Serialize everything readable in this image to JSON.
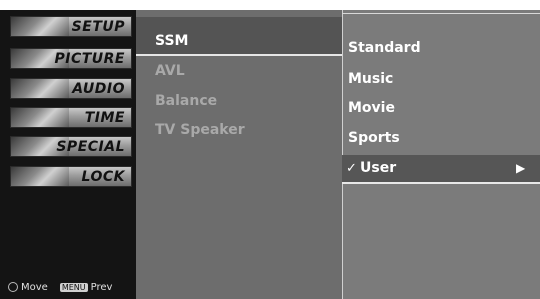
{
  "sidebar": {
    "items": [
      {
        "label": "SETUP"
      },
      {
        "label": "PICTURE"
      },
      {
        "label": "AUDIO"
      },
      {
        "label": "TIME"
      },
      {
        "label": "SPECIAL"
      },
      {
        "label": "LOCK"
      }
    ],
    "help": {
      "move_label": "Move",
      "menu_key": "MENU",
      "prev_label": "Prev"
    }
  },
  "audio_menu": {
    "items": [
      {
        "label": "SSM"
      },
      {
        "label": "AVL"
      },
      {
        "label": "Balance"
      },
      {
        "label": "TV Speaker"
      }
    ]
  },
  "ssm_options": {
    "items": [
      {
        "label": "Standard"
      },
      {
        "label": "Music"
      },
      {
        "label": "Movie"
      },
      {
        "label": "Sports"
      },
      {
        "label": "User",
        "check": "✓",
        "arrow": "▶"
      }
    ]
  },
  "colors": {
    "selected_text": "#ffffff",
    "disabled_text": "#a9a9a9"
  }
}
